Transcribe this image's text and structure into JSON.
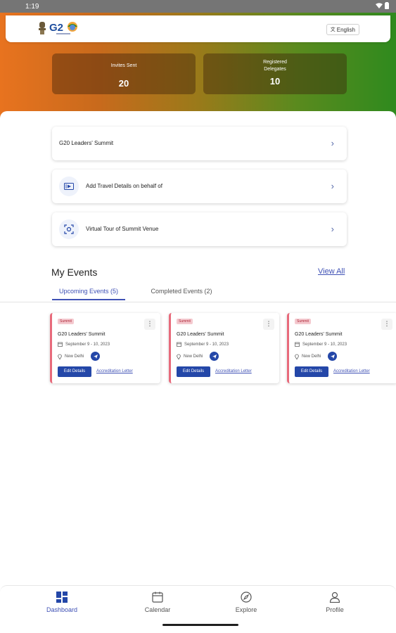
{
  "status_bar": {
    "time": "1:19"
  },
  "header": {
    "language_label": "English",
    "language_icon": "translate-icon"
  },
  "stats": [
    {
      "label_lines": [
        "Invites Sent"
      ],
      "value": "20"
    },
    {
      "label_lines": [
        "Registered",
        "Delegates"
      ],
      "value": "10"
    }
  ],
  "menu": [
    {
      "label": "G20 Leaders' Summit",
      "icon": null
    },
    {
      "label": "Add Travel Details on behalf of",
      "icon": "travel-ticket-icon"
    },
    {
      "label": "Virtual Tour of Summit Venue",
      "icon": "virtual-tour-icon"
    }
  ],
  "my_events": {
    "title": "My Events",
    "view_all": "View All",
    "tabs": [
      {
        "label": "Upcoming Events (5)",
        "active": true
      },
      {
        "label": "Completed Events (2)",
        "active": false
      }
    ],
    "cards": [
      {
        "badge": "Summit",
        "title": "G20 Leaders' Summit",
        "date": "September 9 - 10, 2023",
        "location": "New Delhi",
        "edit_label": "Edit Details",
        "letter_label": "Accreditation Letter"
      },
      {
        "badge": "Summit",
        "title": "G20 Leaders' Summit",
        "date": "September 9 - 10, 2023",
        "location": "New Delhi",
        "edit_label": "Edit Details",
        "letter_label": "Accreditation Letter"
      },
      {
        "badge": "Summit",
        "title": "G20 Leaders' Summit",
        "date": "September 9 - 10, 2023",
        "location": "New Delhi",
        "edit_label": "Edit Details",
        "letter_label": "Accreditation Letter"
      }
    ]
  },
  "bottom_nav": [
    {
      "label": "Dashboard",
      "icon": "dashboard-icon",
      "active": true
    },
    {
      "label": "Calendar",
      "icon": "calendar-icon",
      "active": false
    },
    {
      "label": "Explore",
      "icon": "compass-icon",
      "active": false
    },
    {
      "label": "Profile",
      "icon": "profile-icon",
      "active": false
    }
  ],
  "colors": {
    "accent": "#3f51b5",
    "primary_button": "#2447a8",
    "badge_bg": "#f4c9cf",
    "card_border": "#e86a7b"
  }
}
